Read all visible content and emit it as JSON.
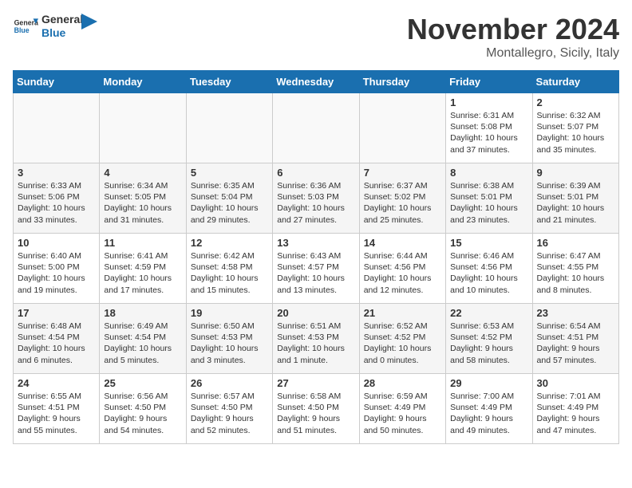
{
  "header": {
    "logo_general": "General",
    "logo_blue": "Blue",
    "month": "November 2024",
    "location": "Montallegro, Sicily, Italy"
  },
  "weekdays": [
    "Sunday",
    "Monday",
    "Tuesday",
    "Wednesday",
    "Thursday",
    "Friday",
    "Saturday"
  ],
  "weeks": [
    [
      {
        "day": "",
        "content": ""
      },
      {
        "day": "",
        "content": ""
      },
      {
        "day": "",
        "content": ""
      },
      {
        "day": "",
        "content": ""
      },
      {
        "day": "",
        "content": ""
      },
      {
        "day": "1",
        "content": "Sunrise: 6:31 AM\nSunset: 5:08 PM\nDaylight: 10 hours\nand 37 minutes."
      },
      {
        "day": "2",
        "content": "Sunrise: 6:32 AM\nSunset: 5:07 PM\nDaylight: 10 hours\nand 35 minutes."
      }
    ],
    [
      {
        "day": "3",
        "content": "Sunrise: 6:33 AM\nSunset: 5:06 PM\nDaylight: 10 hours\nand 33 minutes."
      },
      {
        "day": "4",
        "content": "Sunrise: 6:34 AM\nSunset: 5:05 PM\nDaylight: 10 hours\nand 31 minutes."
      },
      {
        "day": "5",
        "content": "Sunrise: 6:35 AM\nSunset: 5:04 PM\nDaylight: 10 hours\nand 29 minutes."
      },
      {
        "day": "6",
        "content": "Sunrise: 6:36 AM\nSunset: 5:03 PM\nDaylight: 10 hours\nand 27 minutes."
      },
      {
        "day": "7",
        "content": "Sunrise: 6:37 AM\nSunset: 5:02 PM\nDaylight: 10 hours\nand 25 minutes."
      },
      {
        "day": "8",
        "content": "Sunrise: 6:38 AM\nSunset: 5:01 PM\nDaylight: 10 hours\nand 23 minutes."
      },
      {
        "day": "9",
        "content": "Sunrise: 6:39 AM\nSunset: 5:01 PM\nDaylight: 10 hours\nand 21 minutes."
      }
    ],
    [
      {
        "day": "10",
        "content": "Sunrise: 6:40 AM\nSunset: 5:00 PM\nDaylight: 10 hours\nand 19 minutes."
      },
      {
        "day": "11",
        "content": "Sunrise: 6:41 AM\nSunset: 4:59 PM\nDaylight: 10 hours\nand 17 minutes."
      },
      {
        "day": "12",
        "content": "Sunrise: 6:42 AM\nSunset: 4:58 PM\nDaylight: 10 hours\nand 15 minutes."
      },
      {
        "day": "13",
        "content": "Sunrise: 6:43 AM\nSunset: 4:57 PM\nDaylight: 10 hours\nand 13 minutes."
      },
      {
        "day": "14",
        "content": "Sunrise: 6:44 AM\nSunset: 4:56 PM\nDaylight: 10 hours\nand 12 minutes."
      },
      {
        "day": "15",
        "content": "Sunrise: 6:46 AM\nSunset: 4:56 PM\nDaylight: 10 hours\nand 10 minutes."
      },
      {
        "day": "16",
        "content": "Sunrise: 6:47 AM\nSunset: 4:55 PM\nDaylight: 10 hours\nand 8 minutes."
      }
    ],
    [
      {
        "day": "17",
        "content": "Sunrise: 6:48 AM\nSunset: 4:54 PM\nDaylight: 10 hours\nand 6 minutes."
      },
      {
        "day": "18",
        "content": "Sunrise: 6:49 AM\nSunset: 4:54 PM\nDaylight: 10 hours\nand 5 minutes."
      },
      {
        "day": "19",
        "content": "Sunrise: 6:50 AM\nSunset: 4:53 PM\nDaylight: 10 hours\nand 3 minutes."
      },
      {
        "day": "20",
        "content": "Sunrise: 6:51 AM\nSunset: 4:53 PM\nDaylight: 10 hours\nand 1 minute."
      },
      {
        "day": "21",
        "content": "Sunrise: 6:52 AM\nSunset: 4:52 PM\nDaylight: 10 hours\nand 0 minutes."
      },
      {
        "day": "22",
        "content": "Sunrise: 6:53 AM\nSunset: 4:52 PM\nDaylight: 9 hours\nand 58 minutes."
      },
      {
        "day": "23",
        "content": "Sunrise: 6:54 AM\nSunset: 4:51 PM\nDaylight: 9 hours\nand 57 minutes."
      }
    ],
    [
      {
        "day": "24",
        "content": "Sunrise: 6:55 AM\nSunset: 4:51 PM\nDaylight: 9 hours\nand 55 minutes."
      },
      {
        "day": "25",
        "content": "Sunrise: 6:56 AM\nSunset: 4:50 PM\nDaylight: 9 hours\nand 54 minutes."
      },
      {
        "day": "26",
        "content": "Sunrise: 6:57 AM\nSunset: 4:50 PM\nDaylight: 9 hours\nand 52 minutes."
      },
      {
        "day": "27",
        "content": "Sunrise: 6:58 AM\nSunset: 4:50 PM\nDaylight: 9 hours\nand 51 minutes."
      },
      {
        "day": "28",
        "content": "Sunrise: 6:59 AM\nSunset: 4:49 PM\nDaylight: 9 hours\nand 50 minutes."
      },
      {
        "day": "29",
        "content": "Sunrise: 7:00 AM\nSunset: 4:49 PM\nDaylight: 9 hours\nand 49 minutes."
      },
      {
        "day": "30",
        "content": "Sunrise: 7:01 AM\nSunset: 4:49 PM\nDaylight: 9 hours\nand 47 minutes."
      }
    ]
  ]
}
